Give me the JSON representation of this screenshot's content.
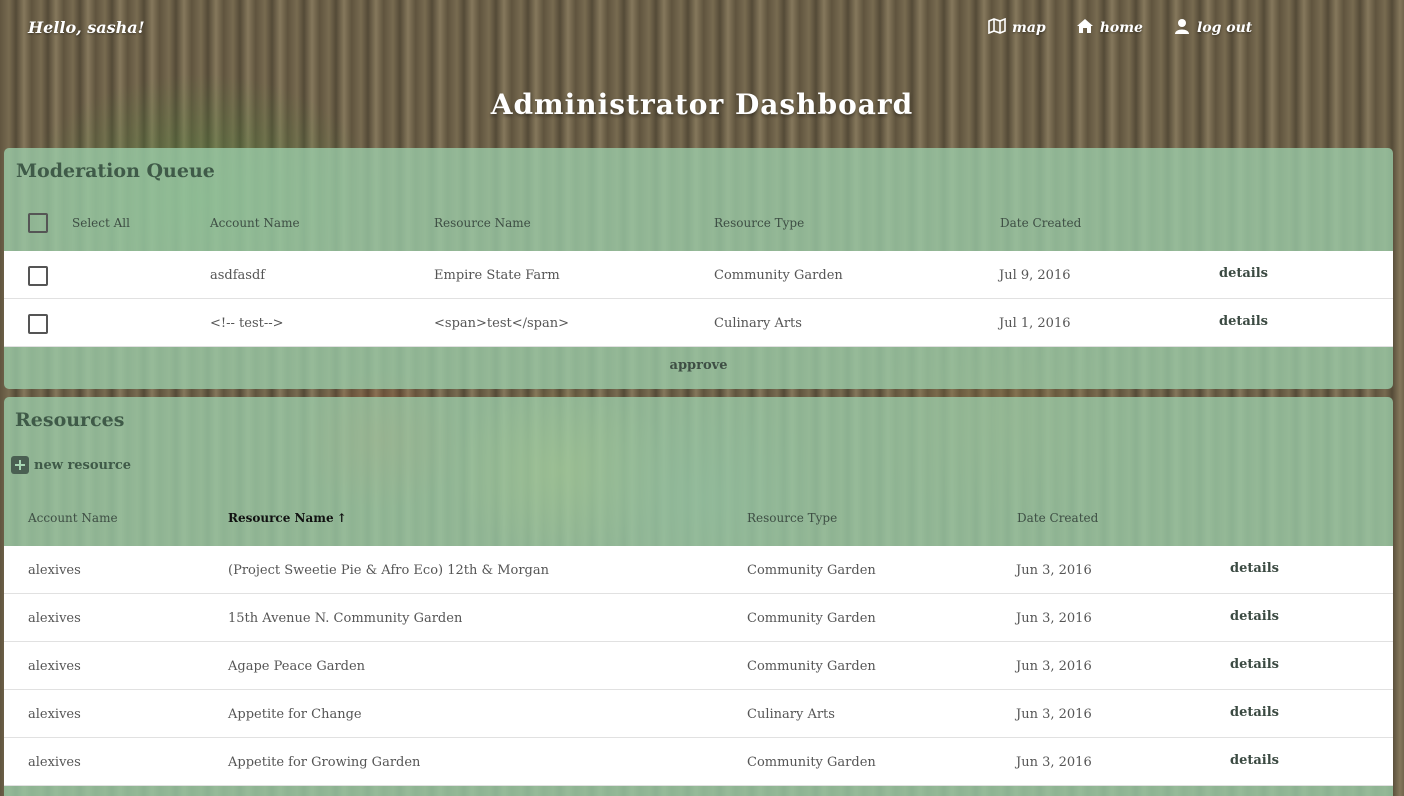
{
  "header": {
    "greeting": "Hello, sasha!",
    "nav": [
      {
        "label": "map",
        "icon": "map-icon"
      },
      {
        "label": "home",
        "icon": "home-icon"
      },
      {
        "label": "log out",
        "icon": "user-icon"
      }
    ]
  },
  "page_title": "Administrator Dashboard",
  "moderation": {
    "title": "Moderation Queue",
    "select_all": "Select All",
    "columns": [
      "Account Name",
      "Resource Name",
      "Resource Type",
      "Date Created"
    ],
    "rows": [
      {
        "account": "asdfasdf",
        "resource": "Empire State Farm",
        "type": "Community Garden",
        "date": "Jul 9, 2016",
        "action": "details"
      },
      {
        "account": "<!-- test-->",
        "resource": "<span>test</span>",
        "type": "Culinary Arts",
        "date": "Jul 1, 2016",
        "action": "details"
      }
    ],
    "approve_label": "approve"
  },
  "resources": {
    "title": "Resources",
    "new_resource_label": "new resource",
    "columns": [
      "Account Name",
      "Resource Name",
      "Resource Type",
      "Date Created"
    ],
    "sort_indicator": "↑",
    "rows": [
      {
        "account": "alexives",
        "resource": "(Project Sweetie Pie & Afro Eco) 12th & Morgan",
        "type": "Community Garden",
        "date": "Jun 3, 2016",
        "action": "details"
      },
      {
        "account": "alexives",
        "resource": "15th Avenue N. Community Garden",
        "type": "Community Garden",
        "date": "Jun 3, 2016",
        "action": "details"
      },
      {
        "account": "alexives",
        "resource": "Agape Peace Garden",
        "type": "Community Garden",
        "date": "Jun 3, 2016",
        "action": "details"
      },
      {
        "account": "alexives",
        "resource": "Appetite for Change",
        "type": "Culinary Arts",
        "date": "Jun 3, 2016",
        "action": "details"
      },
      {
        "account": "alexives",
        "resource": "Appetite for Growing Garden",
        "type": "Community Garden",
        "date": "Jun 3, 2016",
        "action": "details"
      }
    ]
  }
}
